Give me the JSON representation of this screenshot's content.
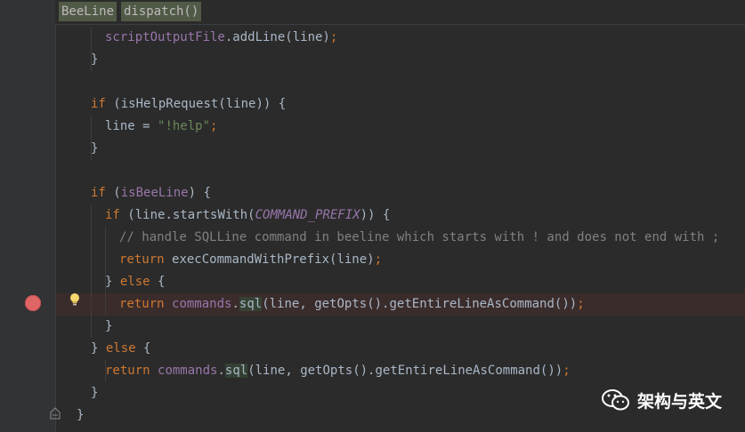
{
  "breadcrumb": [
    "BeeLine",
    "dispatch()"
  ],
  "lines": [
    {
      "indent": 118,
      "tokens": [
        {
          "t": "scriptOutputFile",
          "c": "fld"
        },
        {
          "t": ".addLine(line)",
          "c": "plain"
        },
        {
          "t": ";",
          "c": "semi"
        }
      ]
    },
    {
      "indent": 102,
      "tokens": [
        {
          "t": "}",
          "c": "plain"
        }
      ]
    },
    {
      "indent": 0,
      "tokens": []
    },
    {
      "indent": 102,
      "tokens": [
        {
          "t": "if ",
          "c": "kw"
        },
        {
          "t": "(isHelpRequest(line)) {",
          "c": "plain"
        }
      ]
    },
    {
      "indent": 118,
      "tokens": [
        {
          "t": "line = ",
          "c": "plain"
        },
        {
          "t": "\"!help\"",
          "c": "str"
        },
        {
          "t": ";",
          "c": "semi"
        }
      ]
    },
    {
      "indent": 102,
      "tokens": [
        {
          "t": "}",
          "c": "plain"
        }
      ]
    },
    {
      "indent": 0,
      "tokens": []
    },
    {
      "indent": 102,
      "tokens": [
        {
          "t": "if ",
          "c": "kw"
        },
        {
          "t": "(",
          "c": "plain"
        },
        {
          "t": "isBeeLine",
          "c": "fld"
        },
        {
          "t": ") {",
          "c": "plain"
        }
      ]
    },
    {
      "indent": 118,
      "tokens": [
        {
          "t": "if ",
          "c": "kw"
        },
        {
          "t": "(line.startsWith(",
          "c": "plain"
        },
        {
          "t": "COMMAND_PREFIX",
          "c": "cst"
        },
        {
          "t": ")) {",
          "c": "plain"
        }
      ]
    },
    {
      "indent": 134,
      "tokens": [
        {
          "t": "// handle SQLLine command in beeline which starts with ! and does not end with ;",
          "c": "cmt"
        }
      ]
    },
    {
      "indent": 134,
      "tokens": [
        {
          "t": "return ",
          "c": "kw"
        },
        {
          "t": "execCommandWithPrefix(line)",
          "c": "plain"
        },
        {
          "t": ";",
          "c": "semi"
        }
      ]
    },
    {
      "indent": 118,
      "tokens": [
        {
          "t": "} ",
          "c": "plain"
        },
        {
          "t": "else ",
          "c": "kw"
        },
        {
          "t": "{",
          "c": "plain"
        }
      ]
    },
    {
      "indent": 134,
      "bp": true,
      "tokens": [
        {
          "t": "return ",
          "c": "kw"
        },
        {
          "t": "commands",
          "c": "fld"
        },
        {
          "t": ".",
          "c": "plain"
        },
        {
          "t": "sql",
          "c": "hl"
        },
        {
          "t": "(line, getOpts().getEntireLineAsCommand())",
          "c": "plain"
        },
        {
          "t": ";",
          "c": "semi"
        }
      ]
    },
    {
      "indent": 118,
      "tokens": [
        {
          "t": "}",
          "c": "plain"
        }
      ]
    },
    {
      "indent": 102,
      "tokens": [
        {
          "t": "} ",
          "c": "plain"
        },
        {
          "t": "else ",
          "c": "kw"
        },
        {
          "t": "{",
          "c": "plain"
        }
      ]
    },
    {
      "indent": 118,
      "tokens": [
        {
          "t": "return ",
          "c": "kw"
        },
        {
          "t": "commands",
          "c": "fld"
        },
        {
          "t": ".",
          "c": "plain"
        },
        {
          "t": "sql",
          "c": "hl"
        },
        {
          "t": "(line, getOpts().getEntireLineAsCommand())",
          "c": "plain"
        },
        {
          "t": ";",
          "c": "semi"
        }
      ]
    },
    {
      "indent": 102,
      "tokens": [
        {
          "t": "}",
          "c": "plain"
        }
      ]
    },
    {
      "indent": 86,
      "tokens": [
        {
          "t": "}",
          "c": "plain"
        }
      ]
    }
  ],
  "watermark": {
    "text": "架构与英文",
    "icon": "wechat-icon"
  },
  "colors": {
    "background": "#2b2b2b",
    "keyword": "#cc7832",
    "field": "#9876aa",
    "string": "#6a8759",
    "comment": "#808080",
    "breakpoint": "#e06666"
  }
}
